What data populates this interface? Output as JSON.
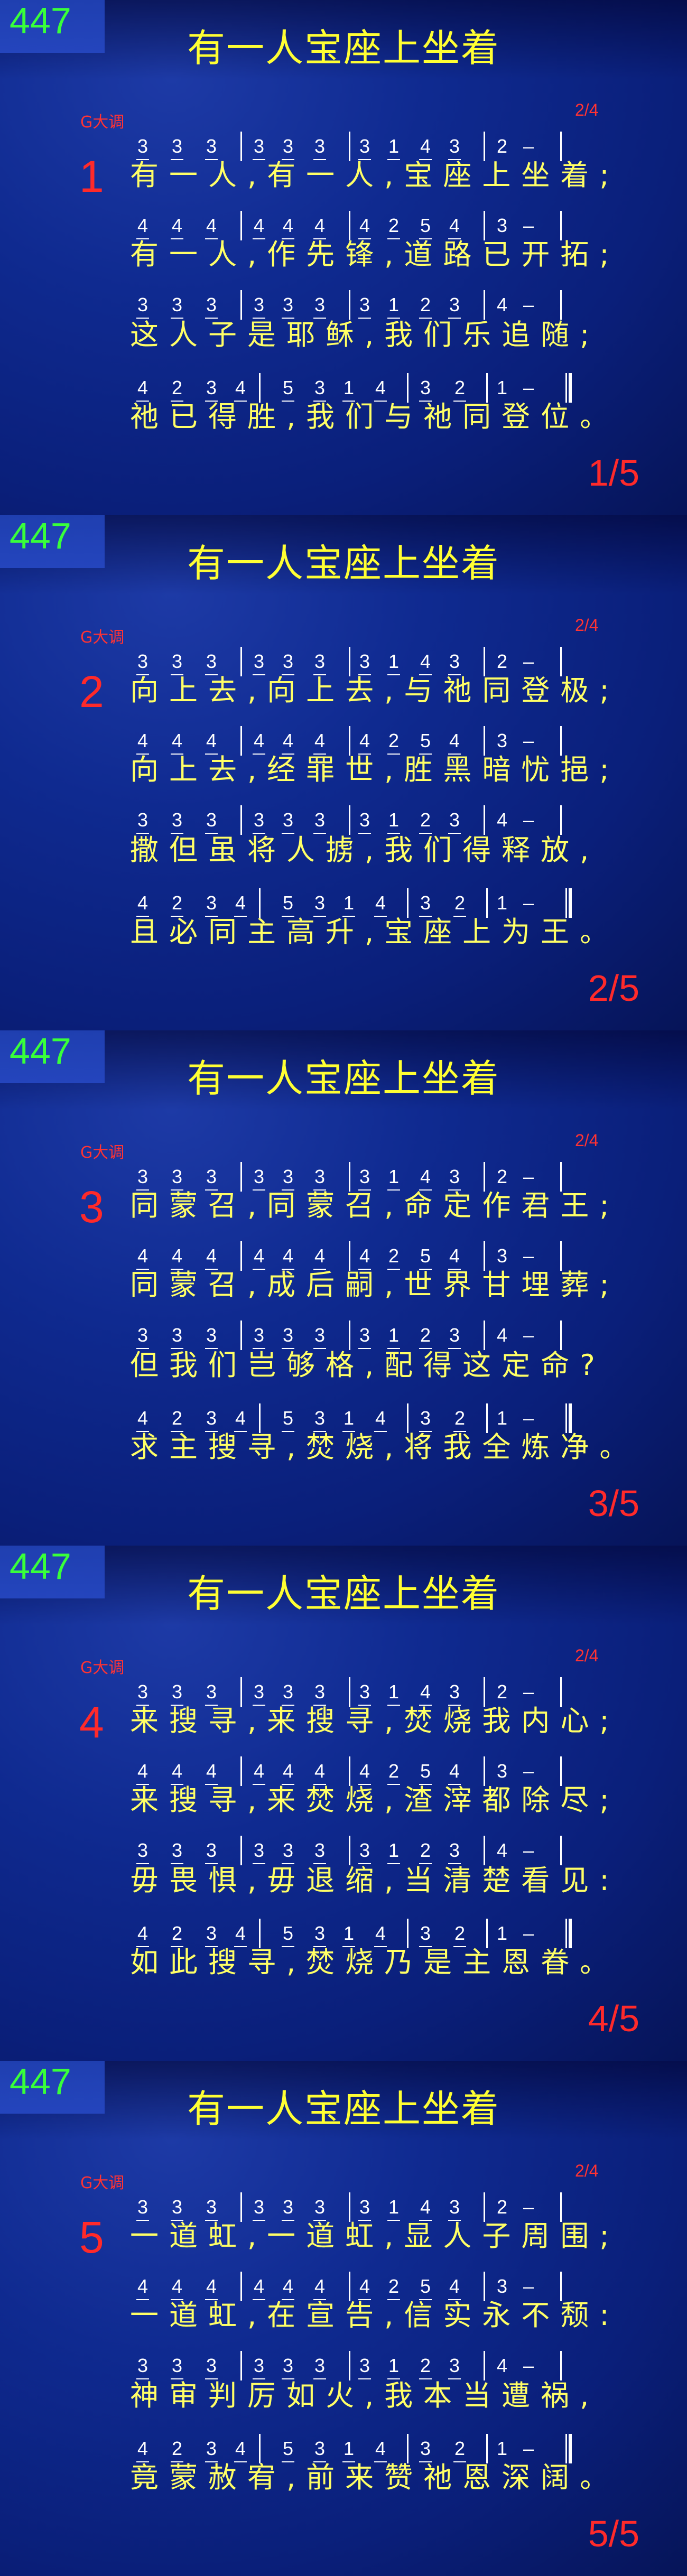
{
  "hymn_number": "447",
  "title": "有一人宝座上坐着",
  "key": "G大调",
  "meter": "2/4",
  "notation_lines": [
    [
      "3",
      "3",
      "3",
      "|",
      "3",
      "3",
      "3",
      "|",
      "3",
      "1",
      "4",
      "3",
      "|",
      "2",
      "–",
      "|"
    ],
    [
      "4",
      "4",
      "4",
      "|",
      "4",
      "4",
      "4",
      "|",
      "4",
      "2",
      "5",
      "4",
      "|",
      "3",
      "–",
      "|"
    ],
    [
      "3",
      "3",
      "3",
      "|",
      "3",
      "3",
      "3",
      "|",
      "3",
      "1",
      "2",
      "3",
      "|",
      "4",
      "–",
      "|"
    ],
    [
      "4",
      "2",
      "3",
      "4",
      "|",
      "5",
      "3",
      "1",
      "4",
      "|",
      "3",
      "2",
      "|",
      "1",
      "–",
      "‖"
    ]
  ],
  "slides": [
    {
      "verse": "1",
      "page": "1/5",
      "lines": [
        "有一人,有一人,宝座上坐着;",
        "有一人,作先锋,道路已开拓;",
        "这人子是耶稣,我们乐追随;",
        "祂已得胜,我们与祂同登位。"
      ]
    },
    {
      "verse": "2",
      "page": "2/5",
      "lines": [
        "向上去,向上去,与祂同登极;",
        "向上去,经罪世,胜黑暗忧挹;",
        "撒但虽将人掳,我们得释放,",
        "且必同主高升,宝座上为王。"
      ]
    },
    {
      "verse": "3",
      "page": "3/5",
      "lines": [
        "同蒙召,同蒙召,命定作君王;",
        "同蒙召,成后嗣,世界甘埋葬;",
        "但我们岂够格,配得这定命?",
        "求主搜寻,焚烧,将我全炼净。"
      ]
    },
    {
      "verse": "4",
      "page": "4/5",
      "lines": [
        "来搜寻,来搜寻,焚烧我内心;",
        "来搜寻,来焚烧,渣滓都除尽;",
        "毋畏惧,毋退缩,当清楚看见:",
        "如此搜寻,焚烧乃是主恩眷。"
      ]
    },
    {
      "verse": "5",
      "page": "5/5",
      "lines": [
        "一道虹,一道虹,显人子周围;",
        "一道虹,在宣告,信实永不颓:",
        "神审判厉如火,我本当遭祸,",
        "竟蒙赦宥,前来赞祂恩深阔。"
      ]
    }
  ]
}
